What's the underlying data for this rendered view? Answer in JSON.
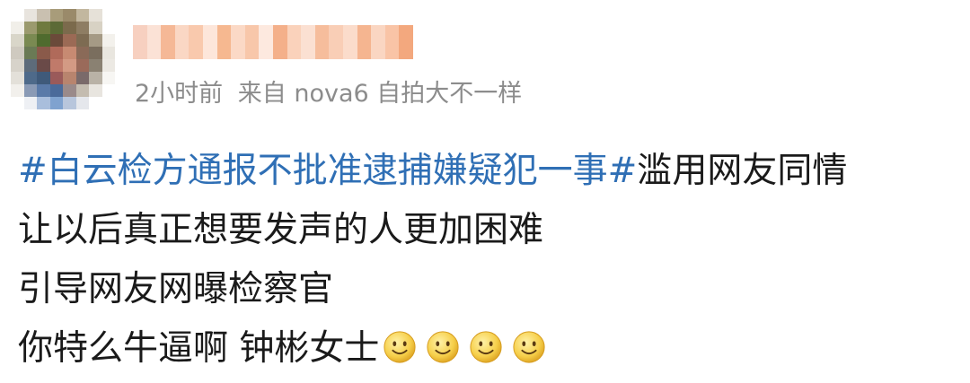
{
  "post": {
    "time": "2小时前",
    "source_prefix": "来自",
    "source_device": "nova6 自拍大不一样",
    "topic": "#白云检方通报不批准逮捕嫌疑犯一事#",
    "line1_rest": "滥用网友同情",
    "line2": "让以后真正想要发声的人更加困难",
    "line3": "引导网友网曝检察官",
    "line4": "你特么牛逼啊 钟彬女士",
    "emojis": [
      "smiley-icon",
      "smiley-icon",
      "smiley-icon",
      "smiley-icon"
    ],
    "colors": {
      "topic_link": "#2f6fb5",
      "meta_text": "#8c8c8c",
      "body_text": "#1a1a1a"
    }
  }
}
